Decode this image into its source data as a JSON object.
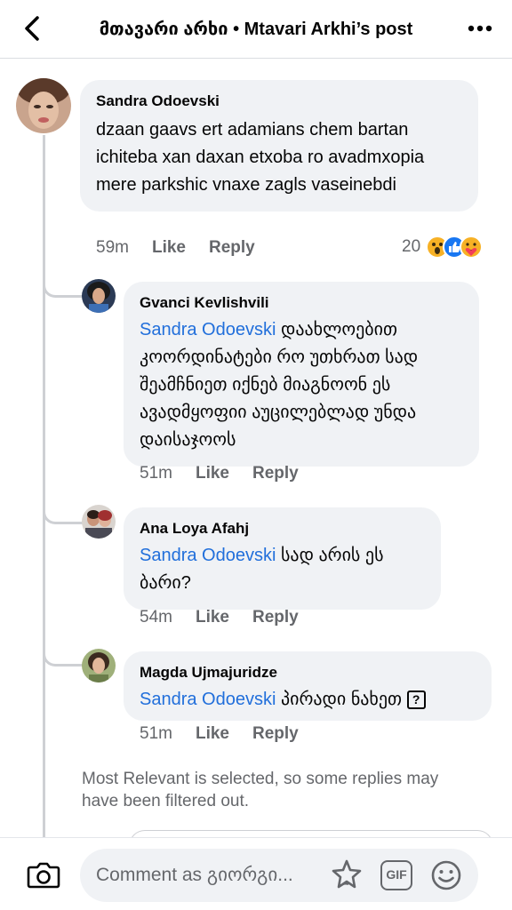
{
  "header": {
    "title": "მთავარი არხი • Mtavari Arkhi’s post"
  },
  "comments": [
    {
      "author": "Sandra Odoevski",
      "text": "dzaan gaavs ert adamians chem bartan ichiteba xan daxan etxoba ro avadmxopia mere parkshic vnaxe zagls vaseinebdi",
      "time": "59m",
      "like": "Like",
      "reply": "Reply",
      "reaction_count": "20",
      "reactions": [
        "wow-icon",
        "like-icon",
        "care-icon"
      ]
    }
  ],
  "replies": [
    {
      "author": "Gvanci Kevlishvili",
      "mention": "Sandra Odoevski",
      "text": " დაახლოებით კოორდინატები რო უთხრათ სად შეამჩნიეთ იქნებ მიაგნოონ ეს ავადმყოფიი აუცილებლად უნდა დაისაჯოოს",
      "time": "51m",
      "like": "Like",
      "reply": "Reply"
    },
    {
      "author": "Ana Loya Afahj",
      "mention": "Sandra Odoevski",
      "text": " სად არის ეს ბარი?",
      "time": "54m",
      "like": "Like",
      "reply": "Reply"
    },
    {
      "author": "Magda Ujmajuridze",
      "mention": "Sandra Odoevski",
      "text": " პირადი ნახეთ ",
      "glyph": "?",
      "time": "51m",
      "like": "Like",
      "reply": "Reply"
    }
  ],
  "filter_note": "Most Relevant is selected, so some replies may have been filtered out.",
  "composer": {
    "placeholder": "Comment as გიორგი...",
    "gif_label": "GIF"
  },
  "colors": {
    "mention": "#216fdb",
    "bubble": "#f0f2f5",
    "secondary_text": "#65676b"
  }
}
